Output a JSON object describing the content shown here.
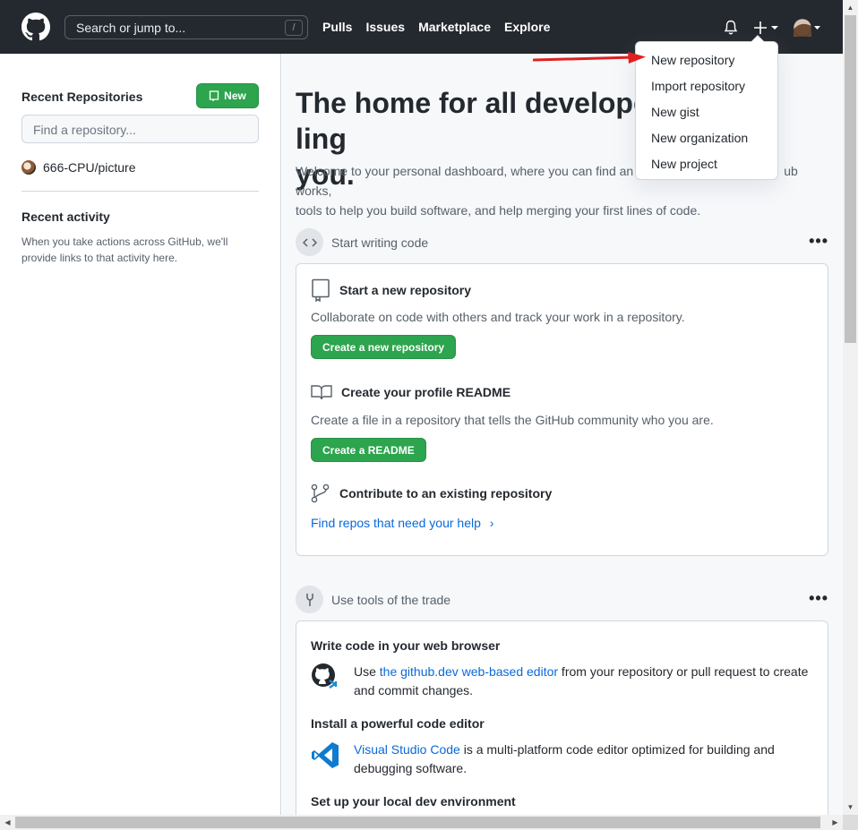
{
  "header": {
    "search_placeholder": "Search or jump to...",
    "search_shortcut": "/",
    "nav": [
      "Pulls",
      "Issues",
      "Marketplace",
      "Explore"
    ],
    "bg_color": "#24292f"
  },
  "sidebar": {
    "recent_title": "Recent Repositories",
    "new_button": "New",
    "find_placeholder": "Find a repository...",
    "repos": [
      {
        "name": "666-CPU/picture"
      }
    ],
    "activity_title": "Recent activity",
    "activity_text": "When you take actions across GitHub, we'll provide links to that activity here."
  },
  "main": {
    "hero_title_part1": "The home for all develope",
    "hero_title_part2": "ling",
    "hero_title_line2": "you.",
    "hero_sub_part1": "Welcome to your personal dashboard, where you can find an",
    "hero_sub_part2": "ub works,",
    "hero_sub_line2": "tools to help you build software, and help merging your first lines of code.",
    "section1": {
      "label": "Start writing code",
      "new_repo_title": "Start a new repository",
      "new_repo_text": "Collaborate on code with others and track your work in a repository.",
      "new_repo_button": "Create a new repository",
      "readme_title": "Create your profile README",
      "readme_text": "Create a file in a repository that tells the GitHub community who you are.",
      "readme_button": "Create a README",
      "contribute_title": "Contribute to an existing repository",
      "contribute_link": "Find repos that need your help"
    },
    "section2": {
      "label": "Use tools of the trade",
      "browser_title": "Write code in your web browser",
      "browser_pre": "Use ",
      "browser_link": "the github.dev web-based editor",
      "browser_post": " from your repository or pull request to create and commit changes.",
      "editor_title": "Install a powerful code editor",
      "editor_link": "Visual Studio Code",
      "editor_post": " is a multi-platform code editor optimized for building and debugging software.",
      "local_title": "Set up your local dev environment"
    }
  },
  "dropdown": {
    "items": [
      "New repository",
      "Import repository",
      "New gist",
      "New organization",
      "New project"
    ]
  },
  "colors": {
    "accent_green": "#2da44e",
    "link_blue": "#0969da",
    "annotation_red": "#e02020"
  }
}
